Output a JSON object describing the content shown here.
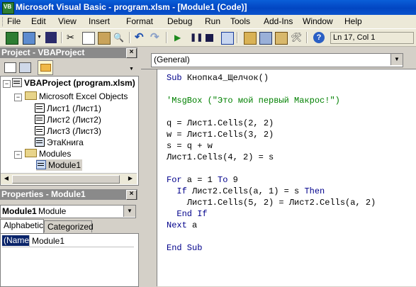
{
  "window": {
    "title": "Microsoft Visual Basic - program.xlsm - [Module1 (Code)]"
  },
  "menu": [
    {
      "label": "File"
    },
    {
      "label": "Edit"
    },
    {
      "label": "View"
    },
    {
      "label": "Insert"
    },
    {
      "label": "Format"
    },
    {
      "label": "Debug"
    },
    {
      "label": "Run"
    },
    {
      "label": "Tools"
    },
    {
      "label": "Add-Ins"
    },
    {
      "label": "Window"
    },
    {
      "label": "Help"
    }
  ],
  "toolbar": {
    "cursor_position": "Ln 17, Col 1"
  },
  "project": {
    "title": "Project - VBAProject",
    "root": "VBAProject (program.xlsm)",
    "folder_excel": "Microsoft Excel Objects",
    "sheets": [
      "Лист1 (Лист1)",
      "Лист2 (Лист2)",
      "Лист3 (Лист3)",
      "ЭтаКнига"
    ],
    "folder_modules": "Modules",
    "module": "Module1"
  },
  "properties": {
    "title": "Properties - Module1",
    "object_name": "Module1",
    "object_type": "Module",
    "tabs": [
      "Alphabetic",
      "Categorized"
    ],
    "rows": [
      {
        "name": "(Name)",
        "value": "Module1"
      }
    ]
  },
  "code": {
    "object_combo": "(General)",
    "lines": [
      "Sub Кнопка4_Щелчок()",
      "",
      "'MsgBox (\"Это мой первый Макрос!\")",
      "",
      "q = Лист1.Cells(2, 2)",
      "w = Лист1.Cells(3, 2)",
      "s = q + w",
      "Лист1.Cells(4, 2) = s",
      "",
      "For a = 1 To 9",
      "  If Лист2.Cells(a, 1) = s Then",
      "    Лист1.Cells(5, 2) = Лист2.Cells(a, 2)",
      "  End If",
      "Next a",
      "",
      "End Sub"
    ]
  }
}
